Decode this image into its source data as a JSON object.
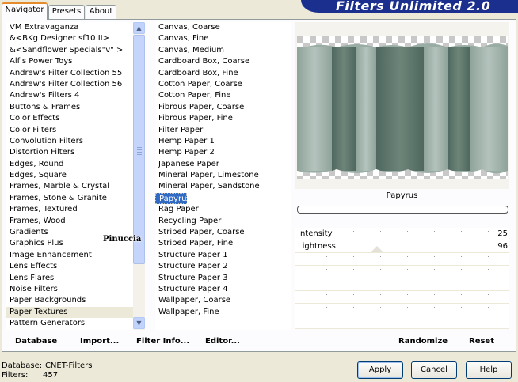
{
  "tabs": [
    {
      "label": "Navigator",
      "active": true
    },
    {
      "label": "Presets",
      "active": false
    },
    {
      "label": "About",
      "active": false
    }
  ],
  "app_title": "Filters Unlimited 2.0",
  "categories": [
    "VM Extravaganza",
    "&<BKg Designer sf10 II>",
    "&<Sandflower Specials\"v\" >",
    "Alf's Power Toys",
    "Andrew's Filter Collection 55",
    "Andrew's Filter Collection 56",
    "Andrew's Filters 4",
    "Buttons & Frames",
    "Color Effects",
    "Color Filters",
    "Convolution Filters",
    "Distortion Filters",
    "Edges, Round",
    "Edges, Square",
    "Frames, Marble & Crystal",
    "Frames, Stone & Granite",
    "Frames, Textured",
    "Frames, Wood",
    "Gradients",
    "Graphics Plus",
    "Image Enhancement",
    "Lens Effects",
    "Lens Flares",
    "Noise Filters",
    "Paper Backgrounds",
    "Paper Textures",
    "Pattern Generators"
  ],
  "selected_category": "Paper Textures",
  "watermark": "Pinuccia",
  "filters": [
    "Canvas, Coarse",
    "Canvas, Fine",
    "Canvas, Medium",
    "Cardboard Box, Coarse",
    "Cardboard Box, Fine",
    "Cotton Paper, Coarse",
    "Cotton Paper, Fine",
    "Fibrous Paper, Coarse",
    "Fibrous Paper, Fine",
    "Filter Paper",
    "Hemp Paper 1",
    "Hemp Paper 2",
    "Japanese Paper",
    "Mineral Paper, Limestone",
    "Mineral Paper, Sandstone",
    "Papyrus",
    "Rag Paper",
    "Recycling Paper",
    "Striped Paper, Coarse",
    "Striped Paper, Fine",
    "Structure Paper 1",
    "Structure Paper 2",
    "Structure Paper 3",
    "Structure Paper 4",
    "Wallpaper, Coarse",
    "Wallpaper, Fine"
  ],
  "selected_filter": "Papyrus",
  "preview": {
    "filter_name": "Papyrus"
  },
  "params": [
    {
      "name": "Intensity",
      "value": "25"
    },
    {
      "name": "Lightness",
      "value": "96"
    }
  ],
  "toolbar": {
    "database": "Database",
    "import": "Import...",
    "filter_info": "Filter Info...",
    "editor": "Editor...",
    "randomize": "Randomize",
    "reset": "Reset"
  },
  "status": {
    "database_label": "Database:",
    "database_value": "ICNET-Filters",
    "filters_label": "Filters:",
    "filters_value": "457"
  },
  "buttons": {
    "apply": "Apply",
    "cancel": "Cancel",
    "help": "Help"
  },
  "colors": {
    "banner": "#1b2f8e",
    "selection": "#316ac5",
    "tab_highlight": "#e68b2c"
  }
}
